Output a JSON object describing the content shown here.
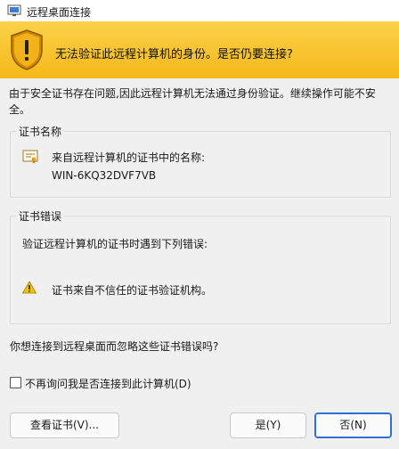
{
  "window": {
    "title": "远程桌面连接"
  },
  "banner": {
    "message": "无法验证此远程计算机的身份。是否仍要连接?"
  },
  "intro": "由于安全证书存在问题,因此远程计算机无法通过身份验证。继续操作可能不安全。",
  "cert_name_group": {
    "label": "证书名称",
    "line1": "来自远程计算机的证书中的名称:",
    "name": "WIN-6KQ32DVF7VB"
  },
  "cert_error_group": {
    "label": "证书错误",
    "intro": "验证远程计算机的证书时遇到下列错误:",
    "error": "证书来自不信任的证书验证机构。"
  },
  "question": "你想连接到远程桌面而忽略这些证书错误吗?",
  "checkbox": {
    "label": "不再询问我是否连接到此计算机(D)",
    "checked": false
  },
  "buttons": {
    "view_cert": "查看证书(V)...",
    "yes": "是(Y)",
    "no": "否(N)"
  },
  "colors": {
    "banner": "#f5b818",
    "focus": "#2f6fd6"
  },
  "icons": [
    "rdp-app-icon",
    "shield-warning-icon",
    "certificate-icon",
    "warning-triangle-icon"
  ]
}
